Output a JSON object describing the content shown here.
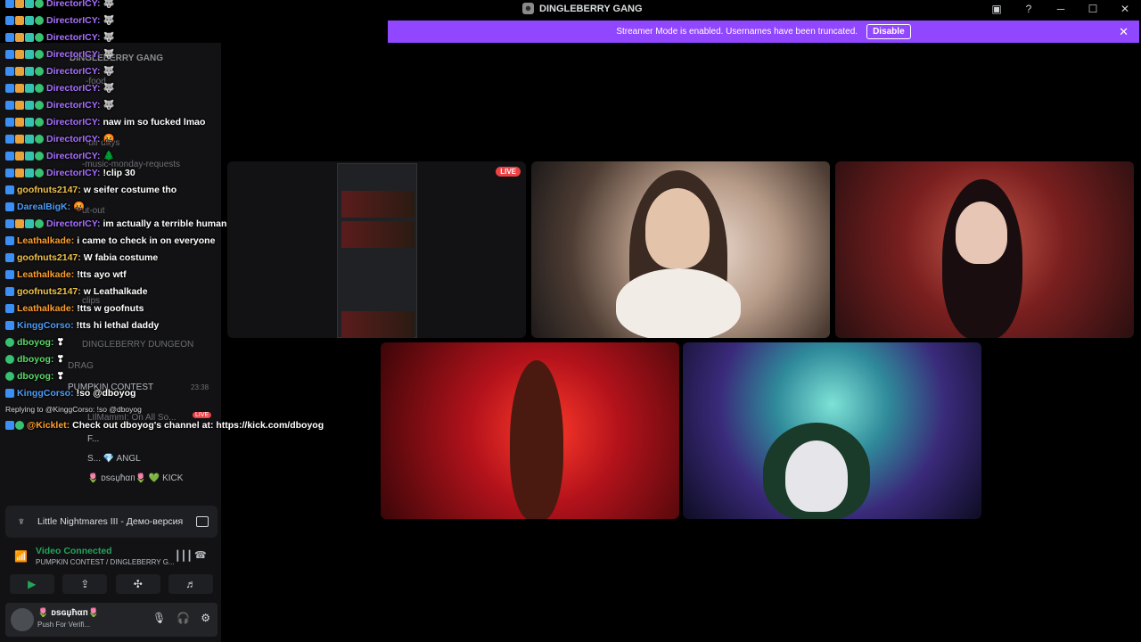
{
  "titlebar": {
    "server_name": "DINGLEBERRY GANG"
  },
  "banner": {
    "message": "Streamer Mode is enabled. Usernames have been truncated.",
    "button": "Disable",
    "close": "✕"
  },
  "sidebar": {
    "rows": [
      "DINGLEBERRY GANG",
      "-food",
      "-bir days",
      "-music-monday-requests",
      "ut-out",
      "clips",
      "DINGLEBERRY DUNGEON",
      "DRAG",
      "PUMPKIN CONTEST",
      "LIlMammI: On All So...",
      "F...",
      "S... 💎 ANGL",
      "🌷 ᴅѕɢџħαп🌷   💚 KICK"
    ],
    "timer": "23:38",
    "live_badge": "LIVE"
  },
  "chat": {
    "messages": [
      {
        "user": "DirectorICY:",
        "text": "🐺",
        "color": "purple"
      },
      {
        "user": "DirectorICY:",
        "text": "🐺",
        "color": "purple"
      },
      {
        "user": "DirectorICY:",
        "text": "🐺",
        "color": "purple"
      },
      {
        "user": "DirectorICY:",
        "text": "🐺",
        "color": "purple"
      },
      {
        "user": "DirectorICY:",
        "text": "🐺",
        "color": "purple"
      },
      {
        "user": "DirectorICY:",
        "text": "🐺",
        "color": "purple"
      },
      {
        "user": "DirectorICY:",
        "text": "🐺",
        "color": "purple"
      },
      {
        "user": "DirectorICY:",
        "text": "naw im so fucked lmao",
        "color": "purple"
      },
      {
        "user": "DirectorICY:",
        "text": "🤬",
        "color": "purple"
      },
      {
        "user": "DirectorICY:",
        "text": "🌲",
        "color": "purple"
      },
      {
        "user": "DirectorICY:",
        "text": "!clip 30",
        "color": "purple"
      },
      {
        "user": "goofnuts2147:",
        "text": "w seifer costume tho",
        "color": "yellow"
      },
      {
        "user": "DarealBigK:",
        "text": "🤬",
        "color": "blue"
      },
      {
        "user": "DirectorICY:",
        "text": "im actually a terrible human lmao",
        "color": "purple"
      },
      {
        "user": "Leathalkade:",
        "text": "i came to check in on everyone",
        "color": "orange"
      },
      {
        "user": "goofnuts2147:",
        "text": "W fabia costume",
        "color": "yellow"
      },
      {
        "user": "Leathalkade:",
        "text": "!tts ayo wtf",
        "color": "orange"
      },
      {
        "user": "goofnuts2147:",
        "text": "w Leathalkade",
        "color": "yellow"
      },
      {
        "user": "Leathalkade:",
        "text": "!tts w goofnuts",
        "color": "orange"
      },
      {
        "user": "KinggCorso:",
        "text": "!tts hi lethal daddy",
        "color": "blue"
      },
      {
        "user": "dboyog:",
        "text": "❣",
        "color": "green"
      },
      {
        "user": "dboyog:",
        "text": "❣",
        "color": "green"
      },
      {
        "user": "dboyog:",
        "text": "❣",
        "color": "green"
      },
      {
        "user": "KinggCorso:",
        "text": "!so @dboyog",
        "color": "blue"
      }
    ],
    "reply_line": "Replying to @KinggCorso: !so @dboyog",
    "bot_message": {
      "user": "@Kicklet:",
      "text": "Check out dboyog's channel at: https://kick.com/dboyog",
      "color": "orange"
    }
  },
  "activity": {
    "game": "Little Nightmares III - Демо-версия"
  },
  "voice": {
    "status": "Video Connected",
    "channel": "PUMPKIN CONTEST / DINGLEBERRY G..."
  },
  "user": {
    "name": "🌷 ᴅѕɢџħαп🌷",
    "status": "Push For Verifi..."
  },
  "tiles": {
    "live_label": "LIVE"
  }
}
